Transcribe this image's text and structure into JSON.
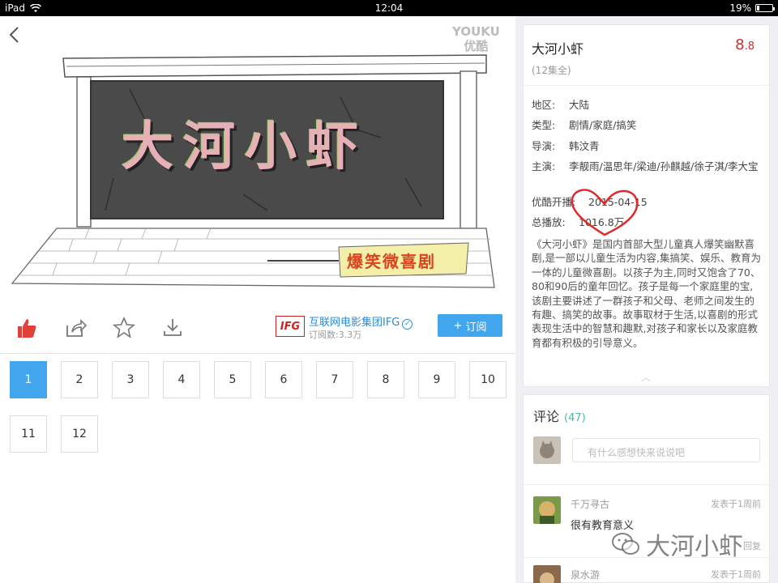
{
  "status_bar": {
    "device": "iPad",
    "time": "12:04",
    "battery": "19%",
    "battery_level": 0.19
  },
  "poster": {
    "title_art": "大河小虾",
    "banner_art": "爆笑微喜剧",
    "watermark_line1": "YOUKU",
    "watermark_line2": "优酷"
  },
  "actions": {
    "channel_logo": "IFG",
    "channel_name": "互联网电影集团IFG",
    "subscribers": "订阅数:3.3万",
    "subscribe_label": "订阅",
    "subscribe_plus": "+"
  },
  "episodes": [
    "1",
    "2",
    "3",
    "4",
    "5",
    "6",
    "7",
    "8",
    "9",
    "10",
    "11",
    "12"
  ],
  "info": {
    "title": "大河小虾",
    "score_int": "8",
    "score_dec": ".8",
    "episode_count": "(12集全)",
    "region_label": "地区:",
    "region": "大陆",
    "genre_label": "类型:",
    "genre": "剧情/家庭/搞笑",
    "director_label": "导演:",
    "director": "韩汶青",
    "cast_label": "主演:",
    "cast": "李靓雨/温思年/梁迪/孙麒越/徐子淇/李大宝",
    "premiere_label": "优酷开播:",
    "premiere": "2015-04-15",
    "plays_label": "总播放:",
    "plays": "1016.8万",
    "description": "《大河小虾》是国内首部大型儿童真人爆笑幽默喜剧,是一部以儿童生活为内容,集搞笑、娱乐、教育为一体的儿童微喜剧。以孩子为主,同时又饱含了70、80和90后的童年回忆。孩子是每一个家庭里的宝,该剧主要讲述了一群孩子和父母、老师之间发生的有趣、搞笑的故事。故事取材于生活,以喜剧的形式表现生活中的智慧和趣默,对孩子和家长以及家庭教育都有积极的引导意义。"
  },
  "comments": {
    "title": "评论",
    "count": "(47)",
    "placeholder": "有什么感想快来说说吧",
    "items": [
      {
        "user": "千万寻古",
        "time": "发表于1周前",
        "text": "很有教育意义",
        "reply": "回复"
      },
      {
        "user": "泉水游",
        "time": "发表于1周前"
      }
    ]
  },
  "wechat_watermark": "大河小虾"
}
